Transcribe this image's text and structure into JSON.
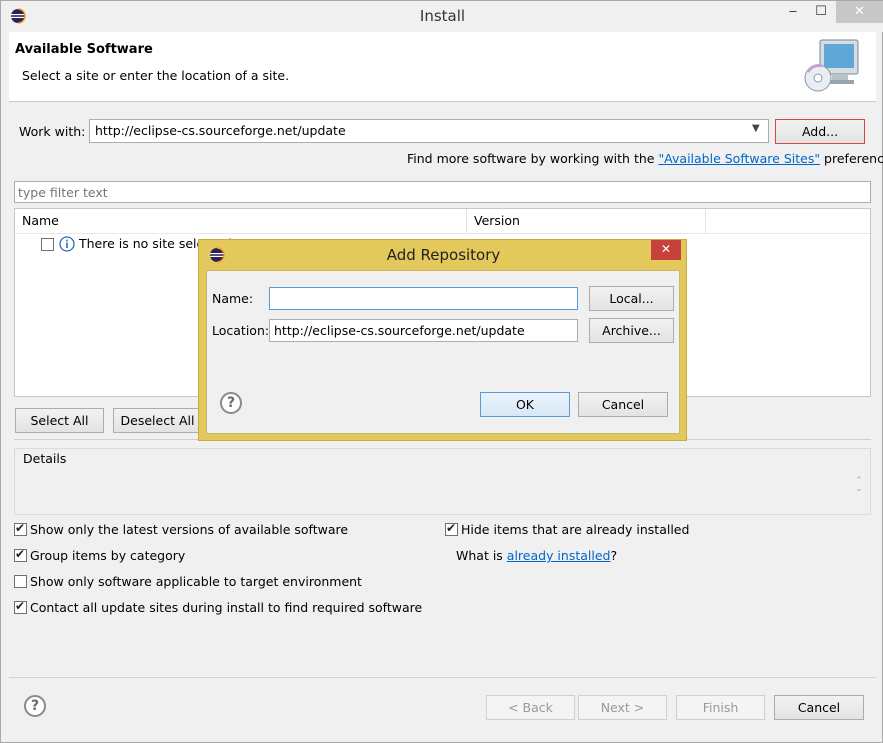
{
  "window": {
    "title": "Install",
    "minimize": "‒",
    "maximize": "☐",
    "close": "✕"
  },
  "banner": {
    "title": "Available Software",
    "subtitle": "Select a site or enter the location of a site."
  },
  "work_with": {
    "label": "Work with:",
    "value": "http://eclipse-cs.sourceforge.net/update",
    "add_label": "Add...",
    "find_more_prefix": "Find more software by working with the ",
    "find_more_link": "\"Available Software Sites\"",
    "find_more_suffix": " preferences."
  },
  "filter": {
    "placeholder": "type filter text"
  },
  "tree": {
    "columns": [
      "Name",
      "Version"
    ],
    "rows": [
      {
        "text": "There is no site selected."
      }
    ]
  },
  "selection_buttons": {
    "select_all": "Select All",
    "deselect_all": "Deselect All"
  },
  "details": {
    "label": "Details"
  },
  "options": {
    "latest_versions": {
      "label": "Show only the latest versions of available software",
      "checked": true
    },
    "group_by_category": {
      "label": "Group items by category",
      "checked": true
    },
    "target_env": {
      "label": "Show only software applicable to target environment",
      "checked": false
    },
    "contact_sites": {
      "label": "Contact all update sites during install to find required software",
      "checked": true
    },
    "hide_installed": {
      "label": "Hide items that are already installed",
      "checked": true
    },
    "what_is_prefix": "What is ",
    "what_is_link": "already installed",
    "what_is_suffix": "?"
  },
  "footer": {
    "back": "< Back",
    "next": "Next >",
    "finish": "Finish",
    "cancel": "Cancel"
  },
  "dialog": {
    "title": "Add Repository",
    "close": "✕",
    "name_label": "Name:",
    "name_value": "",
    "location_label": "Location:",
    "location_value": "http://eclipse-cs.sourceforge.net/update",
    "local_label": "Local...",
    "archive_label": "Archive...",
    "ok_label": "OK",
    "cancel_label": "Cancel"
  },
  "icons": {
    "app": "eclipse-icon",
    "info": "info-icon",
    "help": "help-icon",
    "banner": "install-software-icon",
    "dropdown": "chevron-down-icon"
  }
}
